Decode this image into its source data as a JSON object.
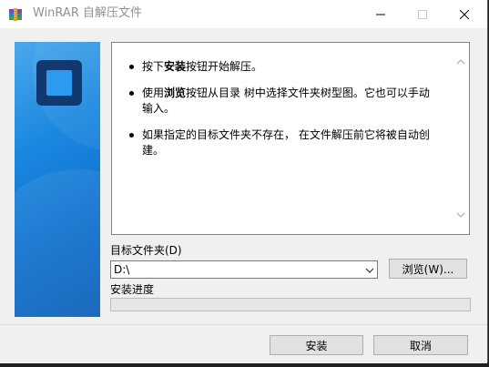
{
  "window": {
    "title": "WinRAR 自解压文件"
  },
  "info": {
    "items": [
      {
        "pre": "按下",
        "bold": "安装",
        "post": "按钮开始解压。"
      },
      {
        "pre": "使用",
        "bold": "浏览",
        "post": "按钮从目录 树中选择文件夹树型图。它也可以手动输入。"
      },
      {
        "pre": "",
        "bold": "",
        "post": "如果指定的目标文件夹不存在， 在文件解压前它将被自动创建。"
      }
    ]
  },
  "dest": {
    "label": "目标文件夹(D)",
    "value": "D:\\"
  },
  "browse_label": "浏览(W)...",
  "progress": {
    "label": "安装进度",
    "value": 0
  },
  "buttons": {
    "install": "安装",
    "cancel": "取消"
  },
  "icons": [
    "winrar-icon",
    "minimize-icon",
    "maximize-icon",
    "close-icon",
    "scroll-up-icon",
    "scroll-down-icon",
    "dropdown-icon"
  ]
}
